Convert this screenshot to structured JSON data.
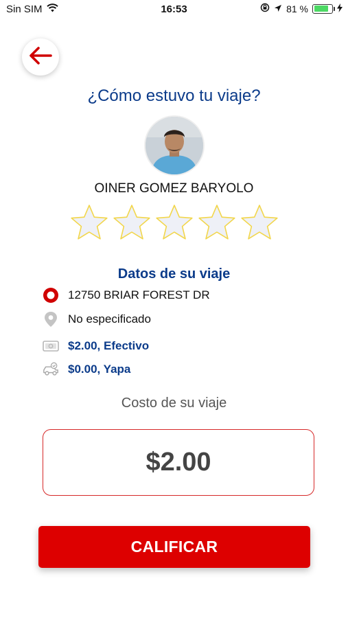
{
  "status_bar": {
    "carrier": "Sin SIM",
    "time": "16:53",
    "battery_percent": "81 %",
    "battery_level": 0.81
  },
  "page": {
    "title": "¿Cómo estuvo tu viaje?"
  },
  "driver": {
    "name": "OINER GOMEZ BARYOLO"
  },
  "rating": {
    "max_stars": 5,
    "selected": 0
  },
  "trip": {
    "section_title": "Datos de su viaje",
    "origin": "12750 BRIAR FOREST DR",
    "destination": "No especificado",
    "payment": "$2.00, Efectivo",
    "tip": "$0.00, Yapa"
  },
  "cost": {
    "label": "Costo de su viaje",
    "value": "$2.00"
  },
  "actions": {
    "rate_label": "CALIFICAR"
  },
  "colors": {
    "accent_red": "#dd0000",
    "title_blue": "#0b3b8a",
    "star_fill": "#eef0f7",
    "star_stroke": "#f2d64b"
  }
}
